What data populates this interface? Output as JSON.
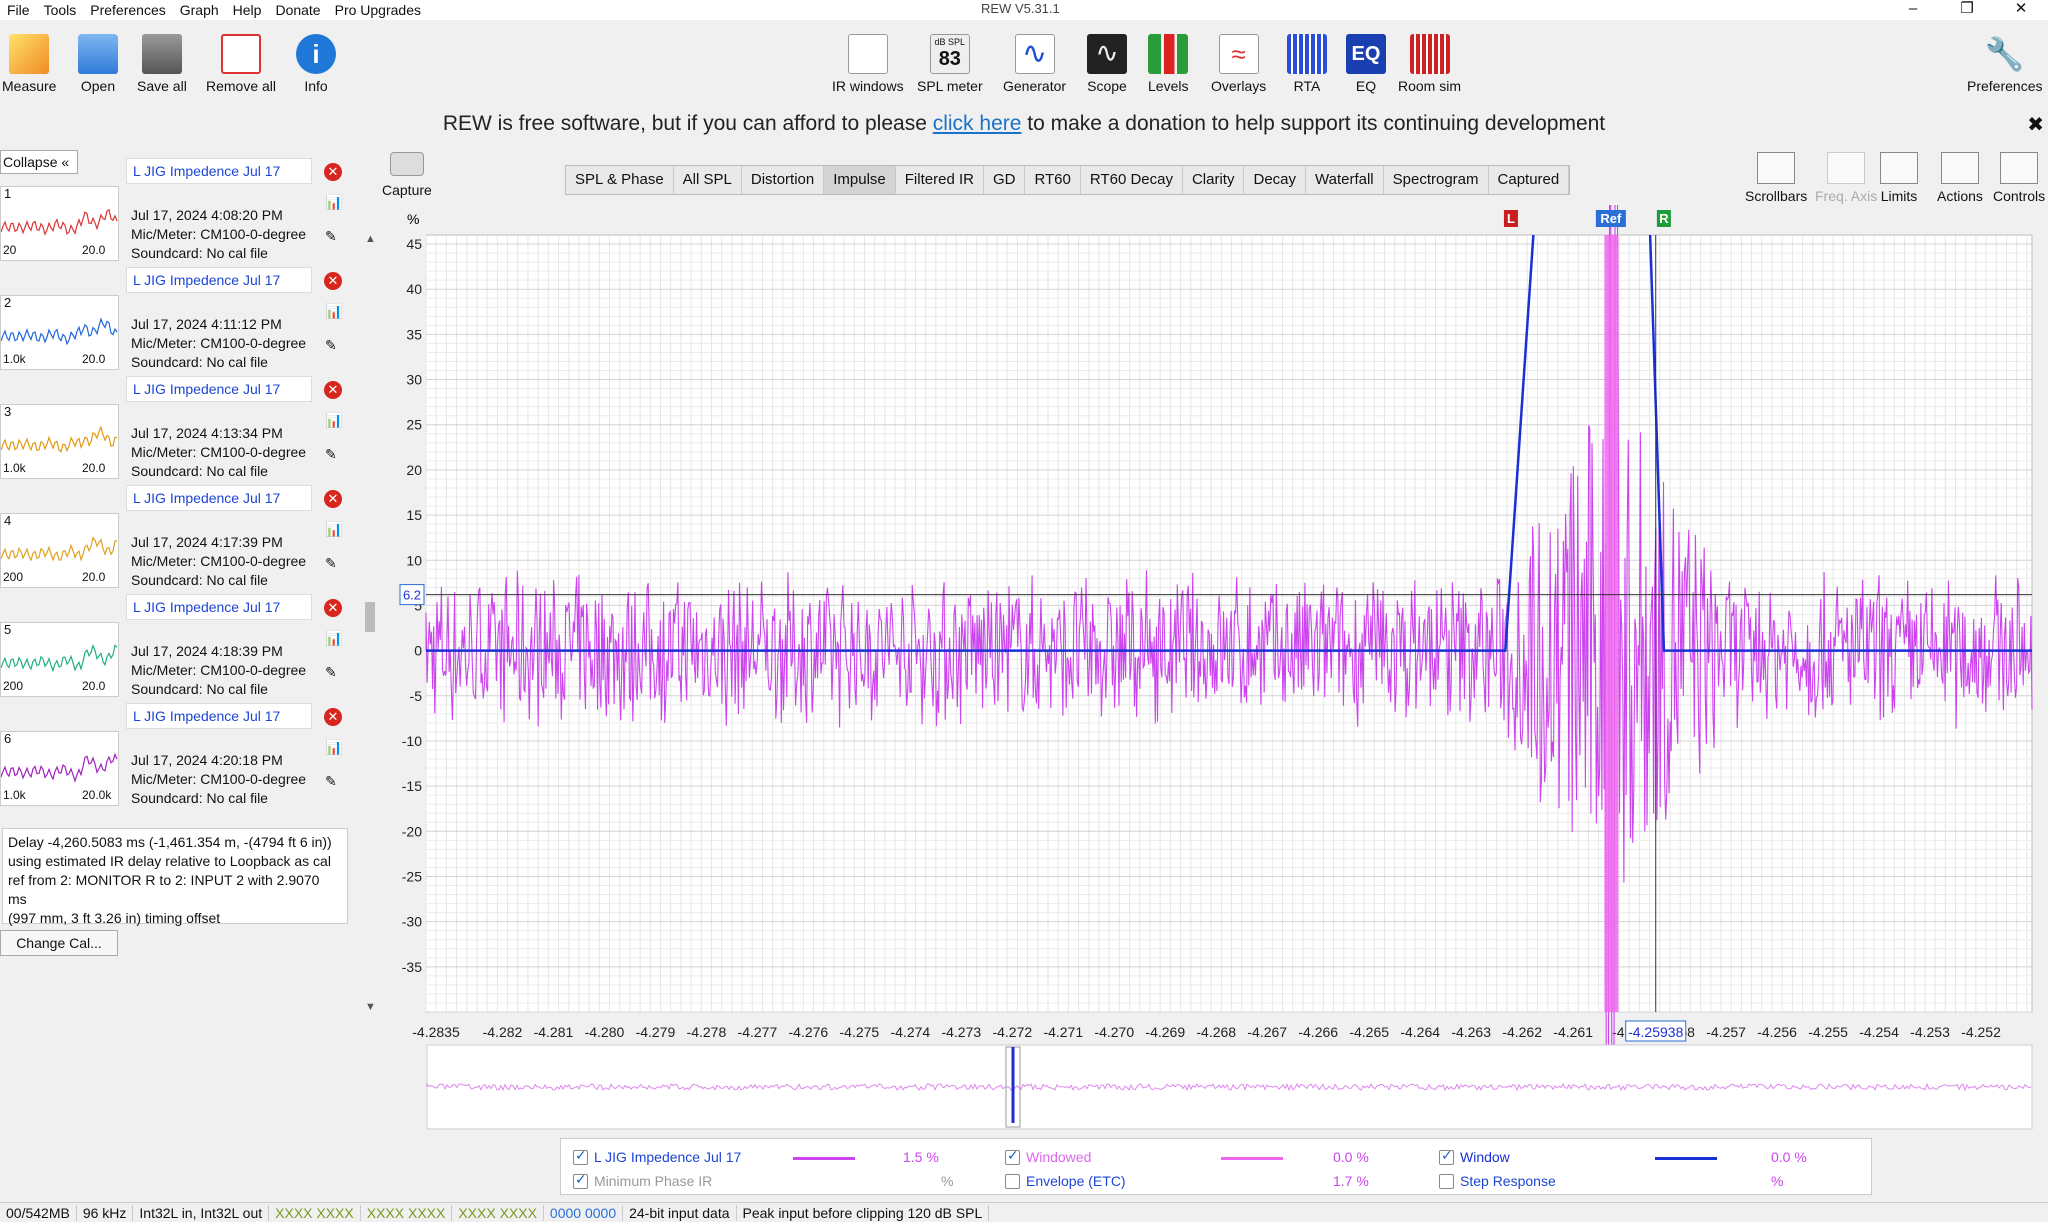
{
  "window": {
    "title": "REW V5.31.1",
    "min": "–",
    "max": "❐",
    "close": "✕"
  },
  "menu": [
    "File",
    "Tools",
    "Preferences",
    "Graph",
    "Help",
    "Donate",
    "Pro Upgrades"
  ],
  "toolbar": {
    "left": [
      {
        "label": "Measure",
        "icon": "measure-icon"
      },
      {
        "label": "Open",
        "icon": "folder-icon"
      },
      {
        "label": "Save all",
        "icon": "save-icon"
      },
      {
        "label": "Remove all",
        "icon": "remove-icon"
      },
      {
        "label": "Info",
        "icon": "info-icon"
      }
    ],
    "center": [
      {
        "label": "IR windows",
        "icon": "ir-windows-icon"
      },
      {
        "label": "SPL meter",
        "icon": "spl-meter-icon",
        "value": "83",
        "badge": "dB SPL"
      },
      {
        "label": "Generator",
        "icon": "generator-icon"
      },
      {
        "label": "Scope",
        "icon": "scope-icon"
      },
      {
        "label": "Levels",
        "icon": "levels-icon"
      },
      {
        "label": "Overlays",
        "icon": "overlays-icon"
      },
      {
        "label": "RTA",
        "icon": "rta-icon"
      },
      {
        "label": "EQ",
        "icon": "eq-icon"
      },
      {
        "label": "Room sim",
        "icon": "room-sim-icon"
      }
    ],
    "preferences": "Preferences"
  },
  "donate": {
    "pre": "REW is free software, but if you can afford to please ",
    "link": "click here",
    "post": " to make a donation to help support its continuing development",
    "close": "✖"
  },
  "panel": {
    "collapse": "Collapse  «",
    "change_cal": "Change Cal..."
  },
  "measurements": [
    {
      "num": "1",
      "name": "L JIG Impedence Jul 17",
      "date": "Jul 17, 2024 4:08:20 PM",
      "mic": "Mic/Meter: CM100-0-degree",
      "sound": "Soundcard: No cal file",
      "xl": "20",
      "xr": "20.0",
      "color": "#d33"
    },
    {
      "num": "2",
      "name": "L JIG Impedence Jul 17",
      "date": "Jul 17, 2024 4:11:12 PM",
      "mic": "Mic/Meter: CM100-0-degree",
      "sound": "Soundcard: No cal file",
      "xl": "1.0k",
      "xr": "20.0",
      "color": "#1e66e0"
    },
    {
      "num": "3",
      "name": "L JIG Impedence Jul 17",
      "date": "Jul 17, 2024 4:13:34 PM",
      "mic": "Mic/Meter: CM100-0-degree",
      "sound": "Soundcard: No cal file",
      "xl": "1.0k",
      "xr": "20.0",
      "color": "#e09a10"
    },
    {
      "num": "4",
      "name": "L JIG Impedence Jul 17",
      "date": "Jul 17, 2024 4:17:39 PM",
      "mic": "Mic/Meter: CM100-0-degree",
      "sound": "Soundcard: No cal file",
      "xl": "200",
      "xr": "20.0",
      "color": "#e0a020"
    },
    {
      "num": "5",
      "name": "L JIG Impedence Jul 17",
      "date": "Jul 17, 2024 4:18:39 PM",
      "mic": "Mic/Meter: CM100-0-degree",
      "sound": "Soundcard: No cal file",
      "xl": "200",
      "xr": "20.0",
      "color": "#20b080"
    },
    {
      "num": "6",
      "name": "L JIG Impedence Jul 17",
      "date": "Jul 17, 2024 4:20:18 PM",
      "mic": "Mic/Meter: CM100-0-degree",
      "sound": "Soundcard: No cal file",
      "xl": "1.0k",
      "xr": "20.0k",
      "color": "#a020c0"
    }
  ],
  "delay_text": [
    "Delay -4,260.5083 ms (-1,461.354 m, -(4794 ft 6 in))",
    "using estimated IR delay relative to Loopback as cal",
    "ref from 2: MONITOR R to 2: INPUT 2 with 2.9070 ms",
    "(997 mm, 3 ft 3.26 in) timing offset"
  ],
  "capture": "Capture",
  "tabs": [
    "SPL & Phase",
    "All SPL",
    "Distortion",
    "Impulse",
    "Filtered IR",
    "GD",
    "RT60",
    "RT60 Decay",
    "Clarity",
    "Decay",
    "Waterfall",
    "Spectrogram",
    "Captured"
  ],
  "active_tab": "Impulse",
  "right_tools": [
    {
      "label": "Scrollbars",
      "icon": "scrollbars-icon"
    },
    {
      "label": "Freq. Axis",
      "icon": "freq-axis-icon",
      "disabled": true
    },
    {
      "label": "Limits",
      "icon": "limits-icon"
    },
    {
      "label": "Actions",
      "icon": "actions-icon"
    },
    {
      "label": "Controls",
      "icon": "controls-icon"
    }
  ],
  "chart_data": {
    "type": "line",
    "ylabel": "%",
    "yticks": [
      45,
      40,
      35,
      30,
      25,
      20,
      15,
      10,
      5,
      0,
      -5,
      -10,
      -15,
      -20,
      -25,
      -30,
      -35
    ],
    "ylim": [
      -40,
      46
    ],
    "xticks": [
      "-4.2835",
      "-4.282",
      "-4.281",
      "-4.280",
      "-4.279",
      "-4.278",
      "-4.277",
      "-4.276",
      "-4.275",
      "-4.274",
      "-4.273",
      "-4.272",
      "-4.271",
      "-4.270",
      "-4.269",
      "-4.268",
      "-4.267",
      "-4.266",
      "-4.265",
      "-4.264",
      "-4.263",
      "-4.262",
      "-4.261",
      "-4.2",
      "-4.258",
      "-4.257",
      "-4.256",
      "-4.255",
      "-4.254",
      "-4.253",
      "-4.252"
    ],
    "xlim": [
      -4.2835,
      -4.252
    ],
    "cursor_x": "-4.25938",
    "cursor_y": "6.2",
    "markers": [
      {
        "label": "L",
        "x": -4.26222,
        "color": "#c81e1e"
      },
      {
        "label": "Ref",
        "x": -4.26026,
        "color": "#2a6fd6"
      },
      {
        "label": "R",
        "x": -4.25922,
        "color": "#1f9d3a"
      }
    ],
    "window": {
      "level": 0,
      "top": 100,
      "rise_start": -4.26233,
      "rise_end": -4.26178,
      "fall_start": -4.25949,
      "fall_end": -4.25922
    },
    "series": [
      {
        "name": "L JIG Impedence Jul 17",
        "color": "#cc44ee"
      },
      {
        "name": "Window",
        "color": "#1a2fd6"
      }
    ]
  },
  "legend": [
    {
      "label": "L JIG Impedence Jul 17",
      "value": "1.5 %",
      "checked": true,
      "color": "#cc44ee"
    },
    {
      "label": "Minimum Phase IR",
      "value": "%",
      "checked": true,
      "disabled": true
    },
    {
      "label": "Windowed",
      "value": "0.0 %",
      "checked": true,
      "color": "#ee66ee",
      "faded": true
    },
    {
      "label": "Envelope (ETC)",
      "value": "1.7 %",
      "checked": false,
      "color": "#cc44ee"
    },
    {
      "label": "Window",
      "value": "0.0 %",
      "checked": true,
      "color": "#1a2fd6"
    },
    {
      "label": "Step Response",
      "value": "%",
      "checked": false
    }
  ],
  "status": [
    "00/542MB",
    "96 kHz",
    "Int32L in, Int32L out",
    "XXXX XXXX",
    "XXXX XXXX",
    "XXXX XXXX",
    "0000 0000",
    "24-bit input data",
    "Peak input before clipping 120 dB SPL"
  ]
}
